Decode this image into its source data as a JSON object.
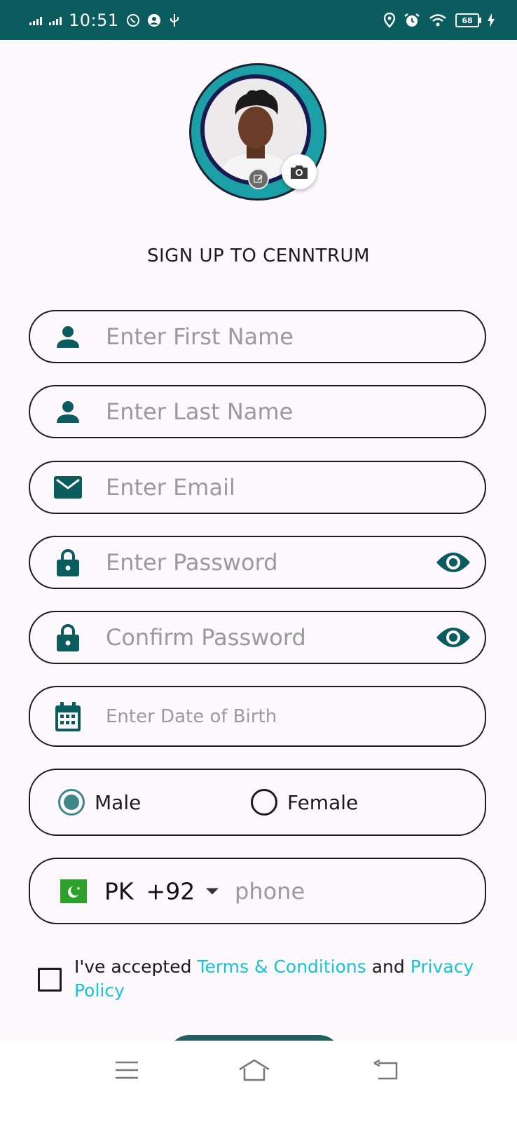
{
  "status_bar": {
    "time": "10:51",
    "battery": "68",
    "bg_color": "#0b5c5e"
  },
  "header": {
    "title": "SIGN UP TO CENNTRUM"
  },
  "form": {
    "first_name": {
      "placeholder": "Enter First Name",
      "icon": "person-icon"
    },
    "last_name": {
      "placeholder": "Enter Last Name",
      "icon": "person-icon"
    },
    "email": {
      "placeholder": "Enter Email",
      "icon": "mail-icon"
    },
    "password": {
      "placeholder": "Enter Password",
      "icon": "lock-icon",
      "toggle_icon": "eye-icon"
    },
    "confirm_password": {
      "placeholder": "Confirm Password",
      "icon": "lock-icon",
      "toggle_icon": "eye-icon"
    },
    "dob": {
      "placeholder": "Enter Date of Birth",
      "icon": "calendar-icon"
    },
    "gender": {
      "options": [
        "Male",
        "Female"
      ],
      "selected": "Male"
    },
    "phone": {
      "country_code": "PK",
      "dial_code": "+92",
      "placeholder": "phone"
    }
  },
  "terms": {
    "prefix": "I've accepted ",
    "terms_link": "Terms & Conditions",
    "and": " and ",
    "privacy_link": "Privacy Policy"
  },
  "colors": {
    "accent": "#0b5c5e",
    "link": "#16c4d6",
    "radio_selected": "#3f8688"
  }
}
